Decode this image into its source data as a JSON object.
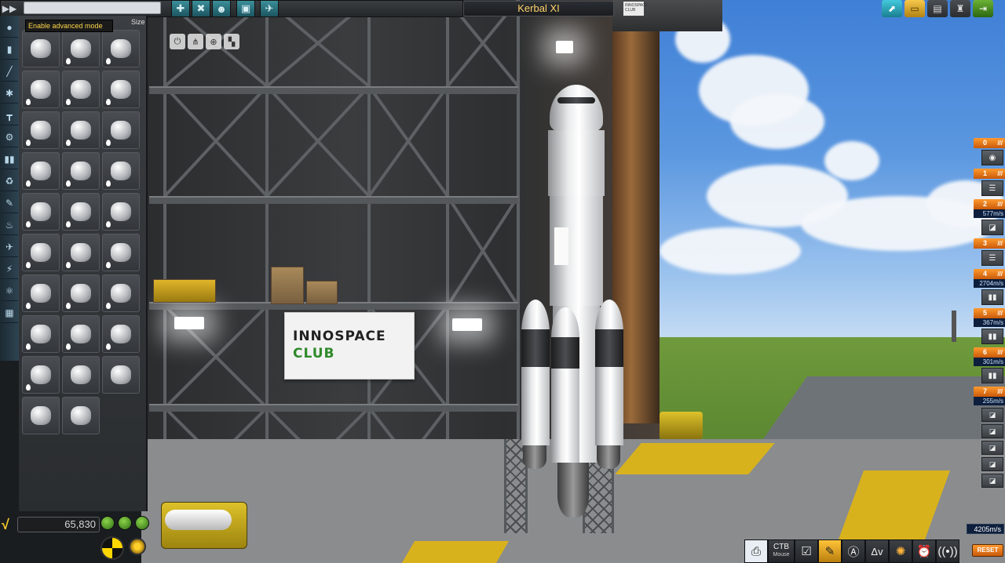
{
  "window": {
    "ship_name": "Kerbal XI"
  },
  "editor": {
    "tooltip": "Enable advanced mode",
    "size_label": "Size",
    "search_placeholder": "",
    "category_icons": [
      "manufacturer-icon",
      "fuel-tank-icon",
      "engine-icon",
      "structural-icon",
      "coupling-icon",
      "payload-icon",
      "aero-icon",
      "ground-icon",
      "thermal-icon",
      "electrical-icon",
      "communication-icon",
      "science-icon",
      "cargo-icon",
      "utility-icon"
    ],
    "part_count": 29
  },
  "toolbar": {
    "mode_buttons": [
      "stock-icon",
      "wrench-icon",
      "kerbal-icon",
      "box-icon",
      "plane-icon"
    ],
    "right_buttons": [
      "launch-icon",
      "folder-icon",
      "save-icon",
      "launchpad-icon",
      "exit-icon"
    ]
  },
  "view_buttons": [
    "symmetry-icon",
    "angle-snap-icon",
    "translate-icon",
    "rotate-icon"
  ],
  "funds": {
    "value": "65,830",
    "currency_symbol": "√"
  },
  "staging": {
    "stages": [
      {
        "num": "0",
        "dv": ""
      },
      {
        "num": "1",
        "dv": ""
      },
      {
        "num": "2",
        "dv": "577m/s"
      },
      {
        "num": "3",
        "dv": ""
      },
      {
        "num": "4",
        "dv": "2704m/s"
      },
      {
        "num": "5",
        "dv": "367m/s"
      },
      {
        "num": "6",
        "dv": "301m/s"
      },
      {
        "num": "7",
        "dv": "255m/s"
      }
    ],
    "total_dv": "4205m/s",
    "reset_label": "RESET"
  },
  "bottom_bar": {
    "ctb_label": "CTB",
    "ctb_sub": "Mouse",
    "dv_label": "Δv"
  },
  "scene": {
    "banner_line1": "INNOSPACE",
    "banner_line2": "CLUB",
    "flag_text": "INNOSPACE CLUB"
  },
  "colors": {
    "accent": "#ffd36a",
    "stage_orange": "#ff9a2e",
    "stage_blue": "#0d1f3c",
    "banner_green": "#2f8a2a"
  }
}
